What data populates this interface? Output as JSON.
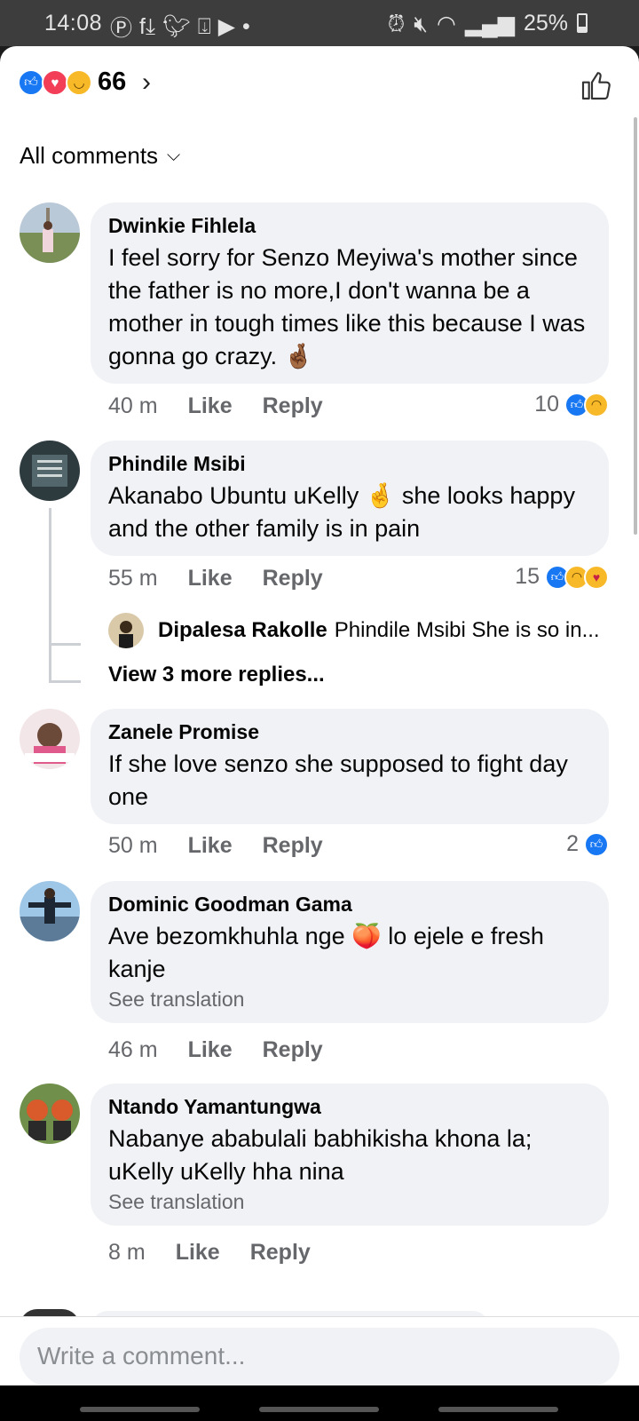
{
  "status": {
    "time": "14:08",
    "battery": "25%",
    "notif_icons": [
      "pinterest-icon",
      "download-icon",
      "twitter-icon",
      "inbox-icon",
      "youtube-icon",
      "dot-icon"
    ],
    "sys_icons": [
      "alarm-icon",
      "mute-icon",
      "wifi-icon",
      "signal-icon"
    ]
  },
  "reactions": {
    "count": "66",
    "chevron": "›"
  },
  "filter": {
    "label": "All comments",
    "chevron": "⌄"
  },
  "comments": [
    {
      "author": "Dwinkie Fihlela",
      "text": "I feel sorry for Senzo Meyiwa's mother since the father is no more,I don't wanna be a mother in tough times like this because I was gonna go crazy. 🤞🏾",
      "time": "40 m",
      "like": "Like",
      "reply": "Reply",
      "reaction_count": "10",
      "reactions": [
        "like",
        "sad"
      ]
    },
    {
      "author": "Phindile Msibi",
      "text": "Akanabo Ubuntu uKelly 🤞 she looks happy and the other family is in pain",
      "time": "55 m",
      "like": "Like",
      "reply": "Reply",
      "reaction_count": "15",
      "reactions": [
        "like",
        "sad",
        "care"
      ],
      "replies": {
        "first_author": "Dipalesa Rakolle",
        "first_snippet": "Phindile Msibi She is so in...",
        "view_more": "View 3 more replies..."
      }
    },
    {
      "author": "Zanele Promise",
      "text": "If she love senzo she supposed to fight day one",
      "time": "50 m",
      "like": "Like",
      "reply": "Reply",
      "reaction_count": "2",
      "reactions": [
        "like"
      ]
    },
    {
      "author": "Dominic Goodman Gama",
      "text": "Ave bezomkhuhla nge 🍑 lo ejele e fresh kanje",
      "see_translation": "See translation",
      "time": "46 m",
      "like": "Like",
      "reply": "Reply"
    },
    {
      "author": "Ntando Yamantungwa",
      "text": "Nabanye ababulali babhikisha khona la; uKelly uKelly hha nina",
      "see_translation": "See translation",
      "time": "8 m",
      "like": "Like",
      "reply": "Reply"
    }
  ],
  "composer": {
    "placeholder": "Write a comment..."
  },
  "colors": {
    "accent": "#1877f2",
    "bubble": "#f0f2f5",
    "meta": "#65676b"
  }
}
